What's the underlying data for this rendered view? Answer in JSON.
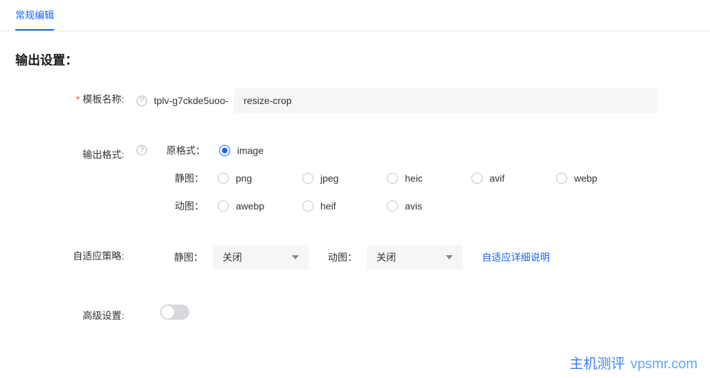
{
  "tabs": {
    "regular_edit": "常规编辑"
  },
  "section": {
    "output_settings": "输出设置："
  },
  "template_name": {
    "label": "模板名称:",
    "prefix": "tplv-g7ckde5uoo-",
    "value": "resize-crop"
  },
  "output_format": {
    "label": "输出格式:",
    "original_label": "原格式：",
    "original_options": [
      "image"
    ],
    "static_label": "静图：",
    "static_options": [
      "png",
      "jpeg",
      "heic",
      "avif",
      "webp"
    ],
    "animated_label": "动图：",
    "animated_options": [
      "awebp",
      "heif",
      "avis"
    ],
    "selected": "image"
  },
  "adaptive_strategy": {
    "label": "自适应策略:",
    "static_label": "静图：",
    "static_value": "关闭",
    "animated_label": "动图：",
    "animated_value": "关闭",
    "detail_link": "自适应详细说明"
  },
  "advanced": {
    "label": "高级设置:",
    "enabled": false
  },
  "watermark": {
    "cn": "主机测评",
    "en": "vpsmr.com"
  }
}
